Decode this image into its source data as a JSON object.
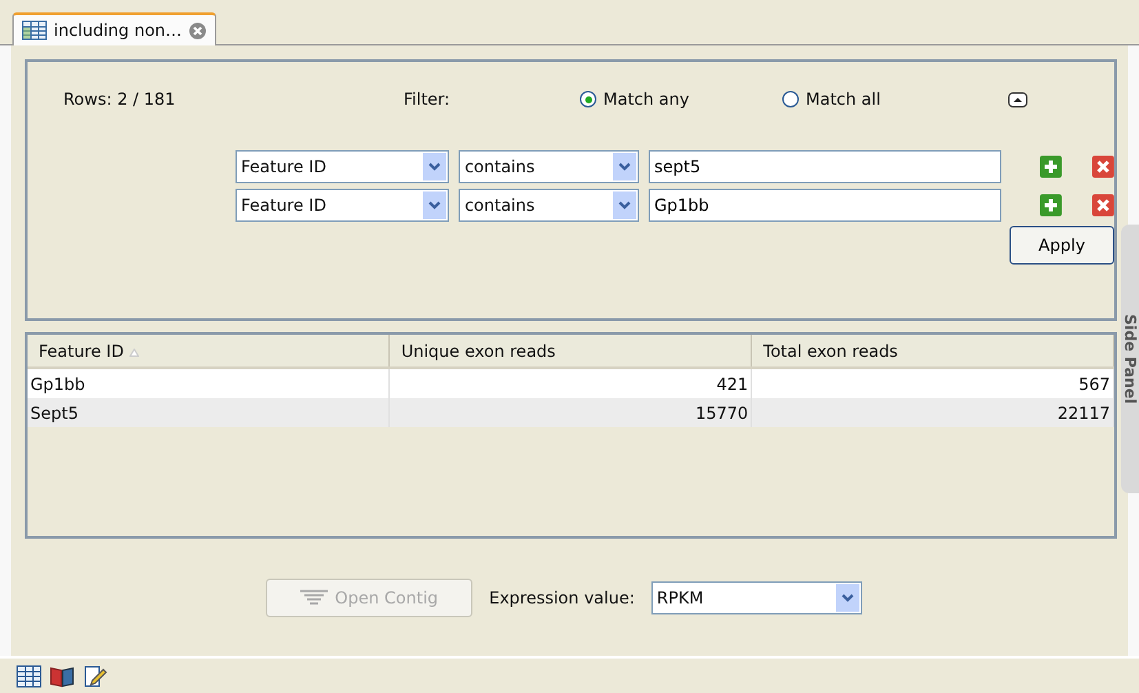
{
  "tab": {
    "title": "including non…"
  },
  "filter": {
    "rows": "Rows: 2 / 181",
    "label": "Filter:",
    "match_options": [
      {
        "label": "Match any",
        "selected": true
      },
      {
        "label": "Match all",
        "selected": false
      }
    ],
    "conditions": [
      {
        "field": "Feature ID",
        "operator": "contains",
        "value": "sept5"
      },
      {
        "field": "Feature ID",
        "operator": "contains",
        "value": "Gp1bb"
      }
    ],
    "apply": "Apply"
  },
  "table": {
    "columns": [
      {
        "label": "Feature ID",
        "sorted": true
      },
      {
        "label": "Unique exon reads",
        "sorted": false
      },
      {
        "label": "Total exon reads",
        "sorted": false
      }
    ],
    "rows": [
      [
        "Gp1bb",
        "421",
        "567"
      ],
      [
        "Sept5",
        "15770",
        "22117"
      ]
    ]
  },
  "actions": {
    "open_contig": {
      "label": "Open Contig",
      "disabled": true
    },
    "expression_label": "Expression value:",
    "expression_value": "RPKM"
  },
  "side_panel": "Side Panel"
}
